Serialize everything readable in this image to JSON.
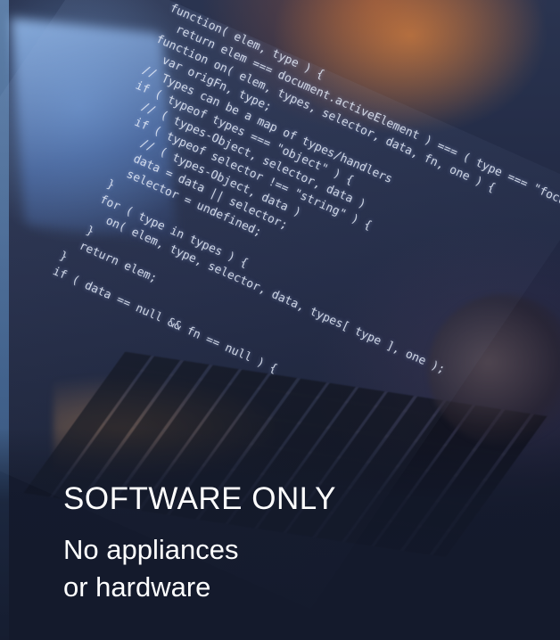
{
  "headline": "SOFTWARE ONLY",
  "subtitle": {
    "line1": "No appliances",
    "line2": "or hardware"
  },
  "code_lines": [
    "function( elem, type ) {",
    "  return elem === document.activeElement ) === ( type === \"focus\" );",
    "function on( elem, types, selector, data, fn, one ) {",
    "  var origFn, type;",
    "// Types can be a map of types/handlers",
    "if ( typeof types === \"object\" ) {",
    "  // ( types-Object, selector, data )",
    "  if ( typeof selector !== \"string\" ) {",
    "    // ( types-Object, data )",
    "    data = data || selector;",
    "    selector = undefined;",
    "  }",
    "  for ( type in types ) {",
    "    on( elem, type, selector, data, types[ type ], one );",
    "  }",
    "  return elem;",
    "}",
    "if ( data == null && fn == null ) {"
  ],
  "colors": {
    "background": "#1a2136",
    "text": "#ffffff",
    "code_text": "#e1e8f5",
    "accent_warm": "#ff9640",
    "accent_cool": "#78aae6"
  }
}
